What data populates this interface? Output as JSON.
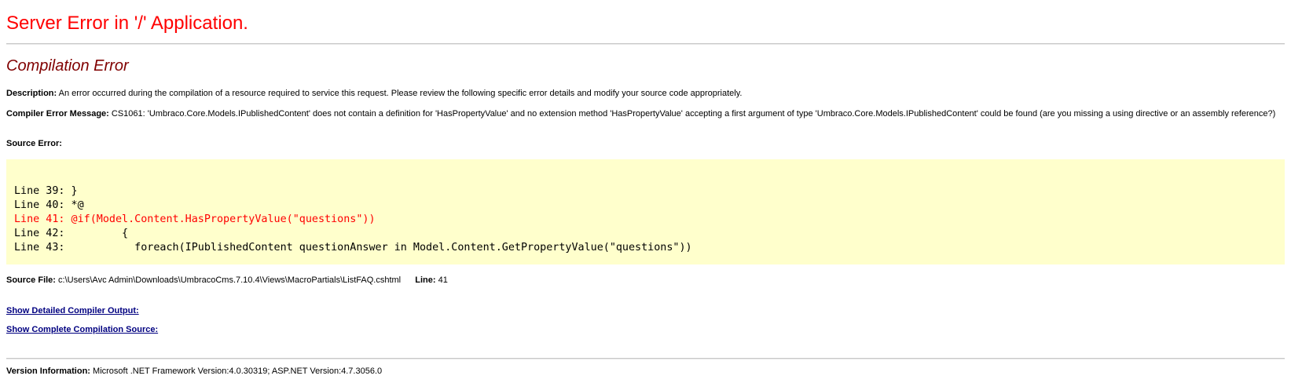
{
  "header": {
    "title": "Server Error in '/' Application.",
    "subtitle": "Compilation Error"
  },
  "description": {
    "label": "Description:",
    "text": "An error occurred during the compilation of a resource required to service this request. Please review the following specific error details and modify your source code appropriately."
  },
  "compiler_error": {
    "label": "Compiler Error Message:",
    "text": "CS1061: 'Umbraco.Core.Models.IPublishedContent' does not contain a definition for 'HasPropertyValue' and no extension method 'HasPropertyValue' accepting a first argument of type 'Umbraco.Core.Models.IPublishedContent' could be found (are you missing a using directive or an assembly reference?)"
  },
  "source_error": {
    "label": "Source Error:",
    "lines": [
      {
        "text": "Line 39: }",
        "error": false
      },
      {
        "text": "Line 40: *@",
        "error": false
      },
      {
        "text": "Line 41: @if(Model.Content.HasPropertyValue(\"questions\"))",
        "error": true
      },
      {
        "text": "Line 42:         {",
        "error": false
      },
      {
        "text": "Line 43:           foreach(IPublishedContent questionAnswer in Model.Content.GetPropertyValue(\"questions\"))",
        "error": false
      }
    ]
  },
  "source_file": {
    "label": "Source File:",
    "path": "c:\\Users\\Avc Admin\\Downloads\\UmbracoCms.7.10.4\\Views\\MacroPartials\\ListFAQ.cshtml",
    "line_label": "Line:",
    "line_value": "41"
  },
  "links": {
    "detailed_output": "Show Detailed Compiler Output:",
    "complete_source": "Show Complete Compilation Source:"
  },
  "version": {
    "label": "Version Information:",
    "text": "Microsoft .NET Framework Version:4.0.30319; ASP.NET Version:4.7.3056.0"
  },
  "colors": {
    "title": "#ff0000",
    "subtitle": "#800000",
    "code_background": "#ffffcc",
    "error_line": "#ff0000",
    "link": "#000080"
  }
}
